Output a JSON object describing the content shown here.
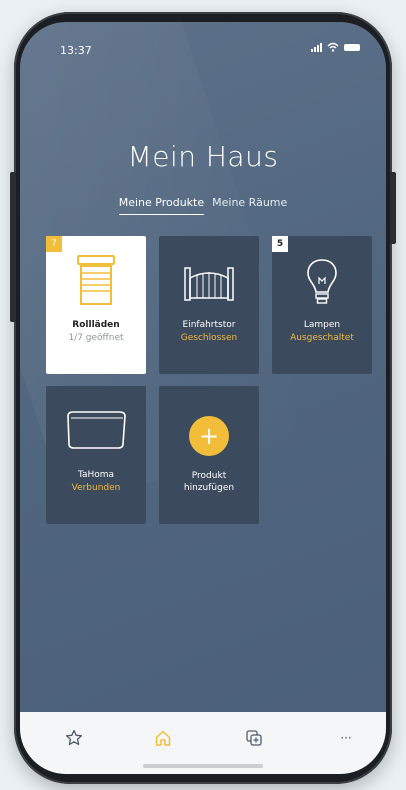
{
  "status_bar": {
    "time": "13:37"
  },
  "page": {
    "title": "Mein Haus"
  },
  "tabs": [
    {
      "label": "Meine Produkte",
      "active": true
    },
    {
      "label": "Meine Räume",
      "active": false
    }
  ],
  "tiles": [
    {
      "badge": "7",
      "name": "Rollläden",
      "status": "1/7 geöffnet",
      "icon": "roller-shutter-icon"
    },
    {
      "name": "Einfahrtstor",
      "status": "Geschlossen",
      "icon": "gate-icon"
    },
    {
      "badge": "5",
      "name": "Lampen",
      "status": "Ausgeschaltet",
      "icon": "light-bulb-icon"
    },
    {
      "name": "TaHoma",
      "status": "Verbunden",
      "icon": "tahoma-box-icon"
    },
    {
      "name_line1": "Produkt",
      "name_line2": "hinzufügen",
      "icon": "plus-icon",
      "glyph": "+"
    }
  ],
  "bottom_nav": [
    {
      "icon": "star-icon"
    },
    {
      "icon": "home-icon",
      "active": true
    },
    {
      "icon": "scenarios-icon"
    },
    {
      "icon": "more-icon",
      "glyph": "···"
    }
  ],
  "colors": {
    "accent": "#f2bd38",
    "tile_bg": "#3c4a5d",
    "screen_bg": "#51667f"
  }
}
